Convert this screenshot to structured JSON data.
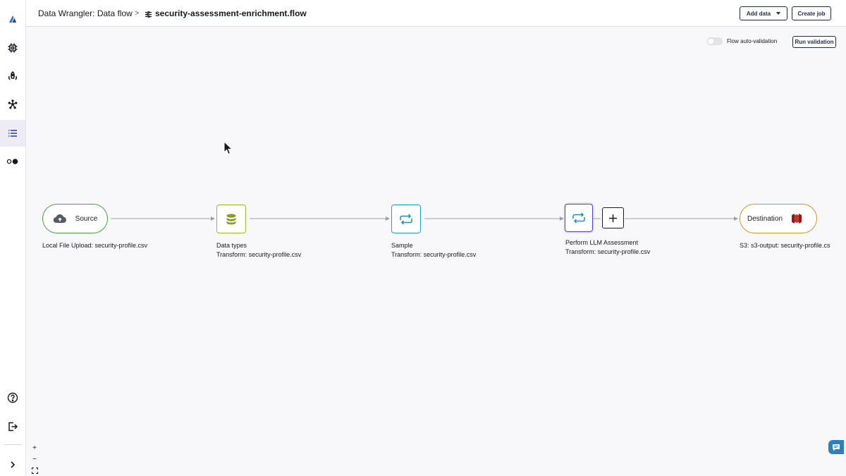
{
  "header": {
    "breadcrumb_parent": "Data Wrangler: Data flow",
    "breadcrumb_separator": ">",
    "flow_name": "security-assessment-enrichment.flow",
    "add_data_label": "Add data",
    "create_job_label": "Create job"
  },
  "toolbar": {
    "auto_validation_label": "Flow auto-validation",
    "auto_validation_on": false,
    "run_validation_label": "Run validation"
  },
  "sidebar": {
    "items": [
      {
        "icon": "sagemaker-logo-icon"
      },
      {
        "icon": "chip-icon"
      },
      {
        "icon": "rocket-icon"
      },
      {
        "icon": "network-icon"
      },
      {
        "icon": "list-icon",
        "active": true
      },
      {
        "icon": "toggle-dots-icon"
      },
      {
        "icon": "help-icon"
      },
      {
        "icon": "sign-out-icon"
      },
      {
        "icon": "chevron-right-icon"
      }
    ]
  },
  "nodes": {
    "source": {
      "title": "Source",
      "label": "Local File Upload: security-profile.csv",
      "color": "#3fa63f"
    },
    "data_types": {
      "title": "Data types",
      "subtitle": "Transform: security-profile.csv",
      "color": "#9fb829"
    },
    "sample": {
      "title": "Sample",
      "subtitle": "Transform: security-profile.csv",
      "color": "#22a2b8"
    },
    "llm": {
      "title": "Perform LLM Assessment",
      "subtitle": "Transform: security-profile.csv",
      "color": "#5b3ec4"
    },
    "destination": {
      "title": "Destination",
      "label": "S3: s3-output: security-profile.cs",
      "color": "#c79a2a"
    }
  },
  "zoom": {
    "zoom_in": "+",
    "zoom_out": "−"
  }
}
